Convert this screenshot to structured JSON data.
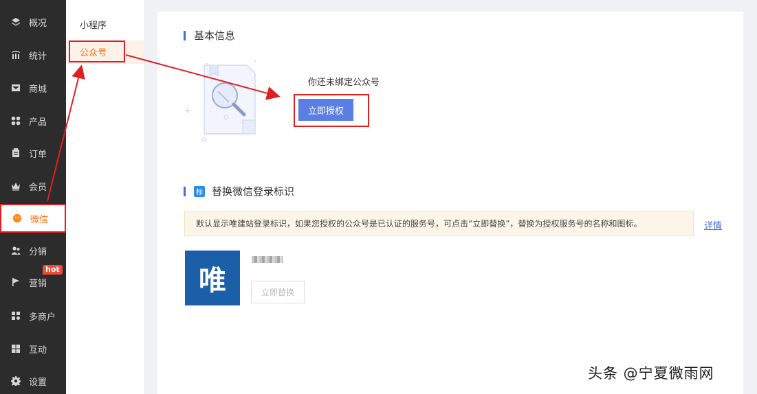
{
  "nav": {
    "items": [
      {
        "label": "概况",
        "icon": "layers-icon"
      },
      {
        "label": "统计",
        "icon": "chart-icon"
      },
      {
        "label": "商城",
        "icon": "mail-icon"
      },
      {
        "label": "产品",
        "icon": "grid-icon"
      },
      {
        "label": "订单",
        "icon": "clipboard-icon"
      },
      {
        "label": "会员",
        "icon": "crown-icon"
      },
      {
        "label": "微信",
        "icon": "wechat-icon"
      },
      {
        "label": "分销",
        "icon": "users-icon"
      },
      {
        "label": "营销",
        "icon": "flag-icon"
      },
      {
        "label": "多商户",
        "icon": "store-icon"
      },
      {
        "label": "互动",
        "icon": "apps-icon"
      },
      {
        "label": "设置",
        "icon": "gear-icon"
      }
    ],
    "active": "微信",
    "hot_badge": "hot"
  },
  "subnav": {
    "items": [
      {
        "label": "小程序"
      },
      {
        "label": "公众号"
      }
    ],
    "active": "公众号"
  },
  "basic_info": {
    "title": "基本信息",
    "status_text": "你还未绑定公众号",
    "authorize_button": "立即授权"
  },
  "replace_section": {
    "badge": "标",
    "title": "替换微信登录标识",
    "notice": "默认显示唯建站登录标识，如果您授权的公众号是已认证的服务号，可点击“立即替换”，替换为授权服务号的名称和图标。",
    "detail_link": "详情",
    "logo_char": "唯",
    "replace_button": "立即替换"
  },
  "watermark": "头条 @宁夏微雨网",
  "colors": {
    "sidebar_bg": "#2c2c2c",
    "accent_orange": "#ff6a00",
    "primary_blue": "#5b7ee5",
    "highlight_red": "#e02020"
  }
}
